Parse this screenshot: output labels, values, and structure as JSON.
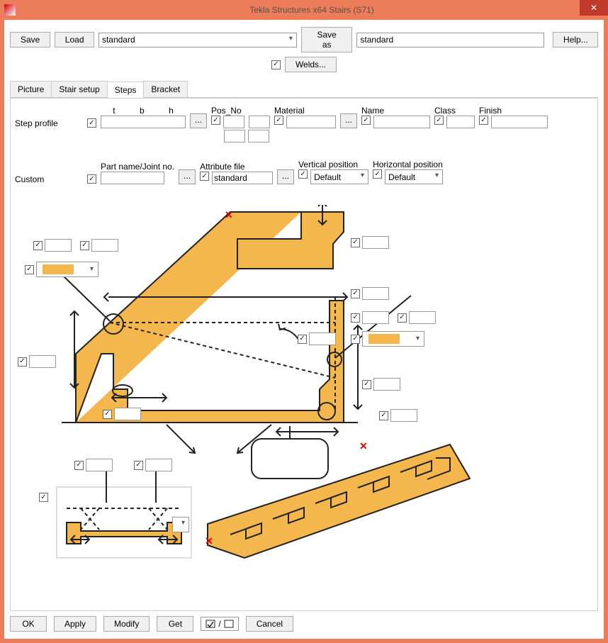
{
  "window": {
    "title": "Tekla Structures x64  Stairs (S71)"
  },
  "top": {
    "save": "Save",
    "load": "Load",
    "preset_selected": "standard",
    "save_as": "Save as",
    "save_as_name": "standard",
    "help": "Help..."
  },
  "welds": {
    "label": "Welds..."
  },
  "tabs": {
    "picture": "Picture",
    "stair_setup": "Stair setup",
    "steps": "Steps",
    "bracket": "Bracket",
    "active": "Steps"
  },
  "steps": {
    "step_profile": "Step profile",
    "tbh": {
      "t": "t",
      "b": "b",
      "h": "h"
    },
    "pos_no": "Pos_No",
    "material": "Material",
    "name": "Name",
    "class": "Class",
    "finish": "Finish",
    "custom": "Custom",
    "part_name_joint": "Part name/Joint no.",
    "attribute_file": "Attribute file",
    "attribute_value": "standard",
    "vertical_position": "Vertical position",
    "vertical_value": "Default",
    "horizontal_position": "Horizontal position",
    "horizontal_value": "Default"
  },
  "bottom": {
    "ok": "OK",
    "apply": "Apply",
    "modify": "Modify",
    "get": "Get",
    "cancel": "Cancel"
  },
  "colors": {
    "stair_fill": "#f4b74e"
  }
}
